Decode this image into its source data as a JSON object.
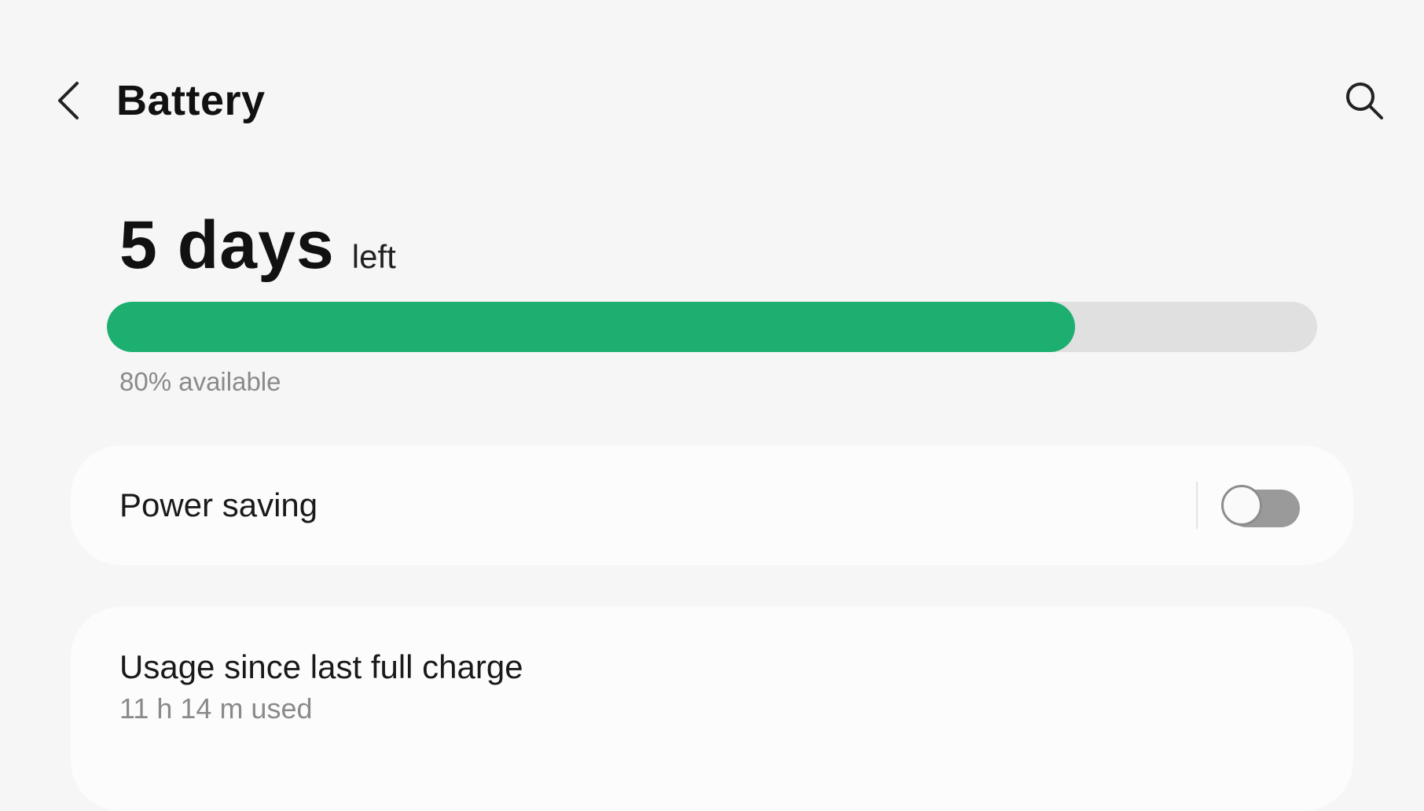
{
  "header": {
    "title": "Battery",
    "back_icon": "chevron-left-icon",
    "search_icon": "search-icon"
  },
  "battery": {
    "time_value": "5 days",
    "time_suffix": "left",
    "level_percent": 80,
    "available_text": "80% available",
    "fill_color": "#1daf70",
    "track_color": "#e0e0e0"
  },
  "power_saving": {
    "label": "Power saving",
    "enabled": false
  },
  "usage": {
    "label": "Usage since last full charge",
    "value": "11 h 14 m used"
  },
  "colors": {
    "background": "#f6f6f6",
    "card": "#fcfcfc",
    "secondary_text": "#8a8a8a",
    "toggle_off": "#9a9a9a"
  }
}
